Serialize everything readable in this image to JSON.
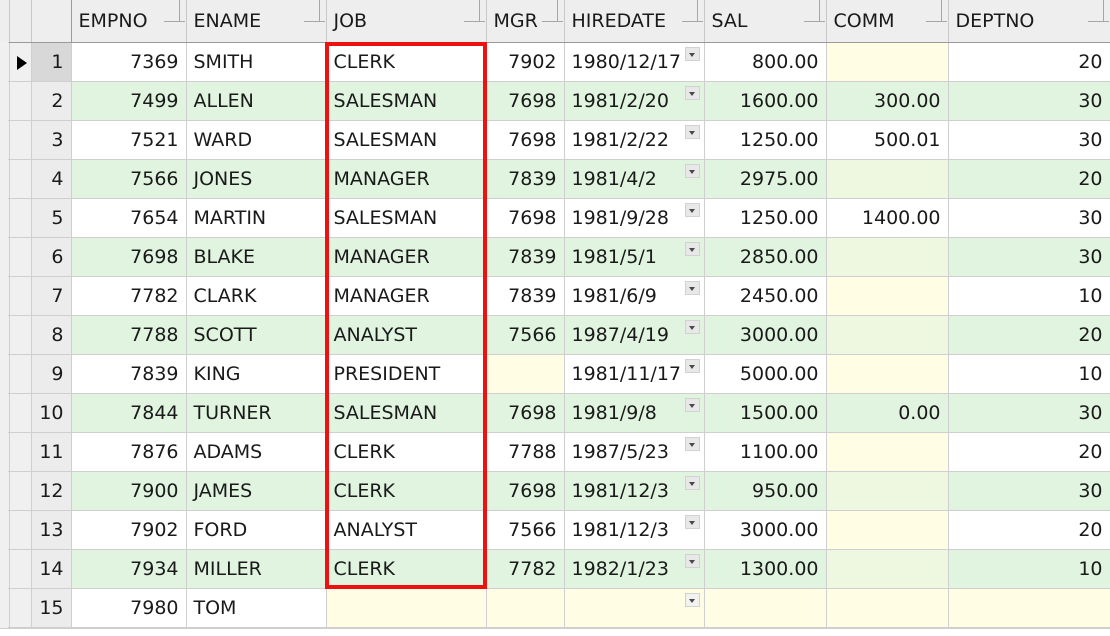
{
  "grid": {
    "row_marker_icon": "current-row-triangle",
    "date_dropdown_icon": "chevron-down-icon",
    "colors": {
      "row_even_background": "#e0f4e0",
      "row_odd_background": "#ffffff",
      "null_cell_background": "#fffde4",
      "header_background": "#eeeeee",
      "highlight_rect": "#ee1111",
      "grid_line": "#cfcfcf",
      "text": "#1a1a1a"
    },
    "columns": [
      {
        "key": "EMPNO",
        "label": "EMPNO",
        "align": "right"
      },
      {
        "key": "ENAME",
        "label": "ENAME",
        "align": "left"
      },
      {
        "key": "JOB",
        "label": "JOB",
        "align": "left"
      },
      {
        "key": "MGR",
        "label": "MGR",
        "align": "right"
      },
      {
        "key": "HIREDATE",
        "label": "HIREDATE",
        "align": "left"
      },
      {
        "key": "SAL",
        "label": "SAL",
        "align": "right"
      },
      {
        "key": "COMM",
        "label": "COMM",
        "align": "right"
      },
      {
        "key": "DEPTNO",
        "label": "DEPTNO",
        "align": "right"
      }
    ],
    "highlighted_column": "JOB",
    "current_row": 1,
    "rows": [
      {
        "n": "1",
        "EMPNO": "7369",
        "ENAME": "SMITH",
        "JOB": "CLERK",
        "MGR": "7902",
        "HIREDATE": "1980/12/17",
        "SAL": "800.00",
        "COMM": "",
        "DEPTNO": "20"
      },
      {
        "n": "2",
        "EMPNO": "7499",
        "ENAME": "ALLEN",
        "JOB": "SALESMAN",
        "MGR": "7698",
        "HIREDATE": "1981/2/20",
        "SAL": "1600.00",
        "COMM": "300.00",
        "DEPTNO": "30"
      },
      {
        "n": "3",
        "EMPNO": "7521",
        "ENAME": "WARD",
        "JOB": "SALESMAN",
        "MGR": "7698",
        "HIREDATE": "1981/2/22",
        "SAL": "1250.00",
        "COMM": "500.01",
        "DEPTNO": "30"
      },
      {
        "n": "4",
        "EMPNO": "7566",
        "ENAME": "JONES",
        "JOB": "MANAGER",
        "MGR": "7839",
        "HIREDATE": "1981/4/2",
        "SAL": "2975.00",
        "COMM": "",
        "DEPTNO": "20"
      },
      {
        "n": "5",
        "EMPNO": "7654",
        "ENAME": "MARTIN",
        "JOB": "SALESMAN",
        "MGR": "7698",
        "HIREDATE": "1981/9/28",
        "SAL": "1250.00",
        "COMM": "1400.00",
        "DEPTNO": "30"
      },
      {
        "n": "6",
        "EMPNO": "7698",
        "ENAME": "BLAKE",
        "JOB": "MANAGER",
        "MGR": "7839",
        "HIREDATE": "1981/5/1",
        "SAL": "2850.00",
        "COMM": "",
        "DEPTNO": "30"
      },
      {
        "n": "7",
        "EMPNO": "7782",
        "ENAME": "CLARK",
        "JOB": "MANAGER",
        "MGR": "7839",
        "HIREDATE": "1981/6/9",
        "SAL": "2450.00",
        "COMM": "",
        "DEPTNO": "10"
      },
      {
        "n": "8",
        "EMPNO": "7788",
        "ENAME": "SCOTT",
        "JOB": "ANALYST",
        "MGR": "7566",
        "HIREDATE": "1987/4/19",
        "SAL": "3000.00",
        "COMM": "",
        "DEPTNO": "20"
      },
      {
        "n": "9",
        "EMPNO": "7839",
        "ENAME": "KING",
        "JOB": "PRESIDENT",
        "MGR": "",
        "HIREDATE": "1981/11/17",
        "SAL": "5000.00",
        "COMM": "",
        "DEPTNO": "10"
      },
      {
        "n": "10",
        "EMPNO": "7844",
        "ENAME": "TURNER",
        "JOB": "SALESMAN",
        "MGR": "7698",
        "HIREDATE": "1981/9/8",
        "SAL": "1500.00",
        "COMM": "0.00",
        "DEPTNO": "30"
      },
      {
        "n": "11",
        "EMPNO": "7876",
        "ENAME": "ADAMS",
        "JOB": "CLERK",
        "MGR": "7788",
        "HIREDATE": "1987/5/23",
        "SAL": "1100.00",
        "COMM": "",
        "DEPTNO": "20"
      },
      {
        "n": "12",
        "EMPNO": "7900",
        "ENAME": "JAMES",
        "JOB": "CLERK",
        "MGR": "7698",
        "HIREDATE": "1981/12/3",
        "SAL": "950.00",
        "COMM": "",
        "DEPTNO": "30"
      },
      {
        "n": "13",
        "EMPNO": "7902",
        "ENAME": "FORD",
        "JOB": "ANALYST",
        "MGR": "7566",
        "HIREDATE": "1981/12/3",
        "SAL": "3000.00",
        "COMM": "",
        "DEPTNO": "20"
      },
      {
        "n": "14",
        "EMPNO": "7934",
        "ENAME": "MILLER",
        "JOB": "CLERK",
        "MGR": "7782",
        "HIREDATE": "1982/1/23",
        "SAL": "1300.00",
        "COMM": "",
        "DEPTNO": "10"
      },
      {
        "n": "15",
        "EMPNO": "7980",
        "ENAME": "TOM",
        "JOB": "",
        "MGR": "",
        "HIREDATE": "",
        "SAL": "",
        "COMM": "",
        "DEPTNO": ""
      }
    ]
  }
}
